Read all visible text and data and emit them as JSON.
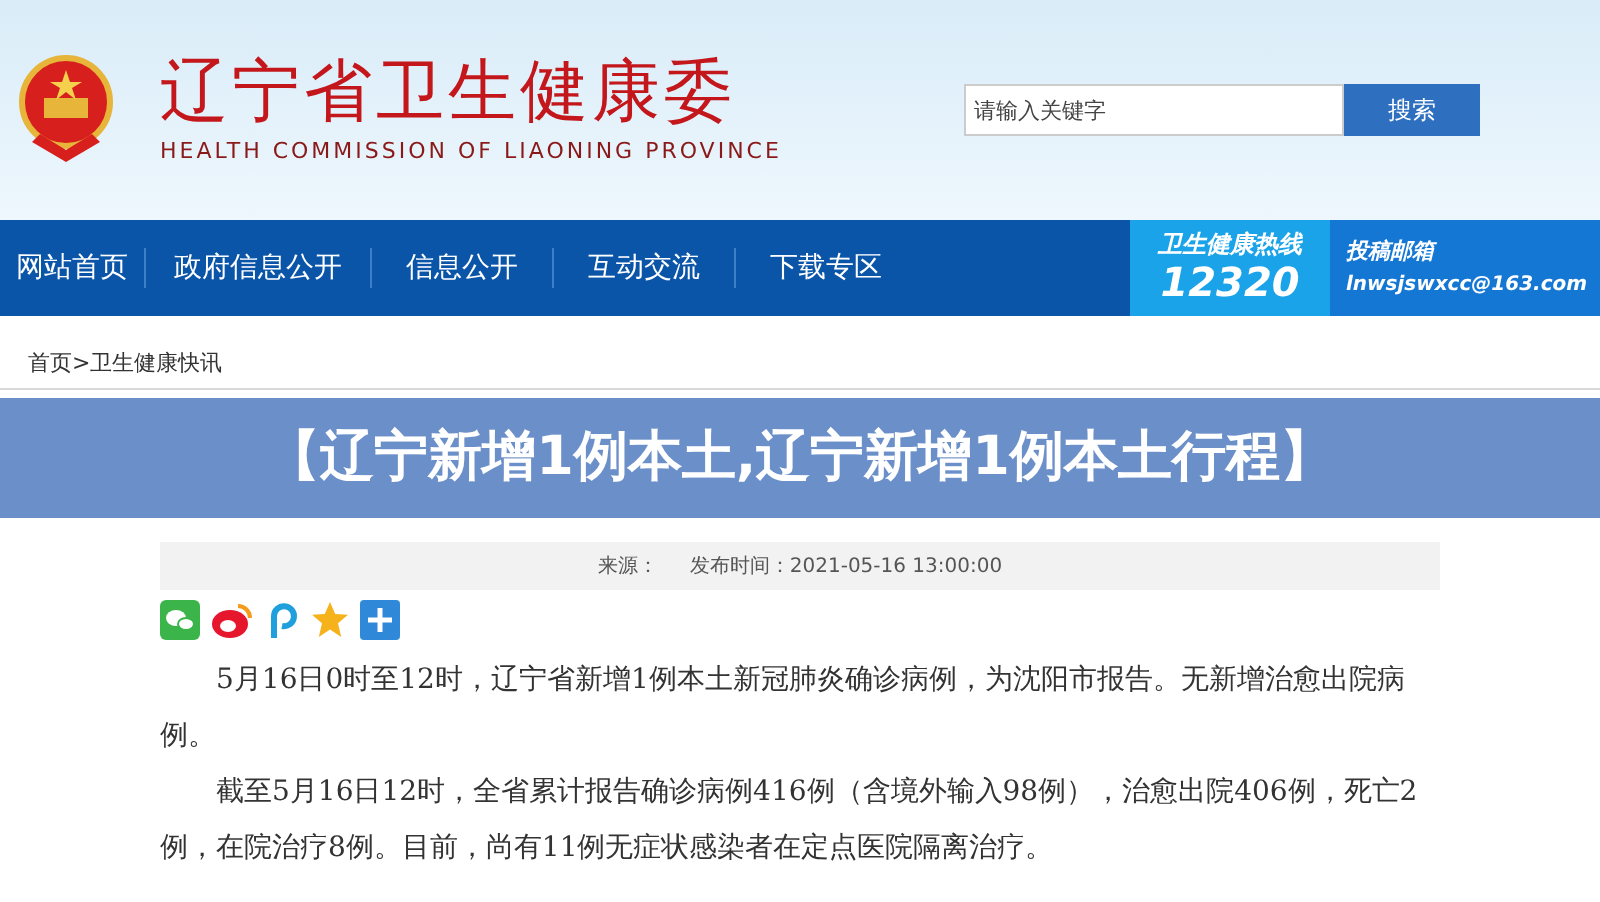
{
  "header": {
    "title": "辽宁省卫生健康委",
    "subtitle": "HEALTH COMMISSION OF LIAONING PROVINCE",
    "search": {
      "placeholder": "请输入关键字",
      "button": "搜索"
    }
  },
  "nav": {
    "items": [
      {
        "label": "网站首页"
      },
      {
        "label": "政府信息公开"
      },
      {
        "label": "信息公开"
      },
      {
        "label": "互动交流"
      },
      {
        "label": "下载专区"
      }
    ],
    "hotline": {
      "label": "卫生健康热线",
      "number": "12320"
    },
    "mailbox": {
      "label": "投稿邮箱",
      "email": "lnwsjswxcc@163.com"
    }
  },
  "breadcrumb": [
    "首页",
    ">",
    "卫生健康快讯"
  ],
  "banner": "【辽宁新增1例本土,辽宁新增1例本土行程】",
  "meta": {
    "source": "来源：",
    "published": "发布时间：2021-05-16 13:00:00"
  },
  "share": [
    {
      "kind": "wechat"
    },
    {
      "kind": "weibo"
    },
    {
      "kind": "p"
    },
    {
      "kind": "star"
    },
    {
      "kind": "plus"
    }
  ],
  "paragraphs": [
    "5月16日0时至12时，辽宁省新增1例本土新冠肺炎确诊病例，为沈阳市报告。无新增治愈出院病例。",
    "截至5月16日12时，全省累计报告确诊病例416例（含境外输入98例），治愈出院406例，死亡2例，在院治疗8例。目前，尚有11例无症状感染者在定点医院隔离治疗。"
  ]
}
